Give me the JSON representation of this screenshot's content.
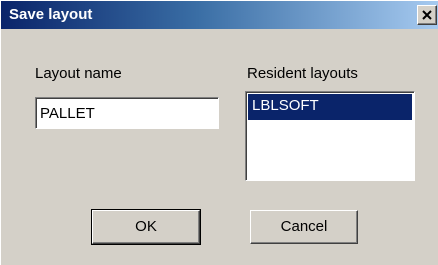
{
  "window": {
    "title": "Save layout",
    "close_icon": "close-icon"
  },
  "layout_name": {
    "label": "Layout name",
    "value": "PALLET"
  },
  "resident_layouts": {
    "label": "Resident layouts",
    "items": [
      {
        "label": "LBLSOFT",
        "selected": true
      }
    ]
  },
  "buttons": {
    "ok_label": "OK",
    "cancel_label": "Cancel"
  },
  "colors": {
    "dialog_bg": "#d4d0c8",
    "titlebar_start": "#0a246a",
    "titlebar_end": "#a6caf0",
    "selection_bg": "#0a246a",
    "selection_text": "#ffffff"
  }
}
